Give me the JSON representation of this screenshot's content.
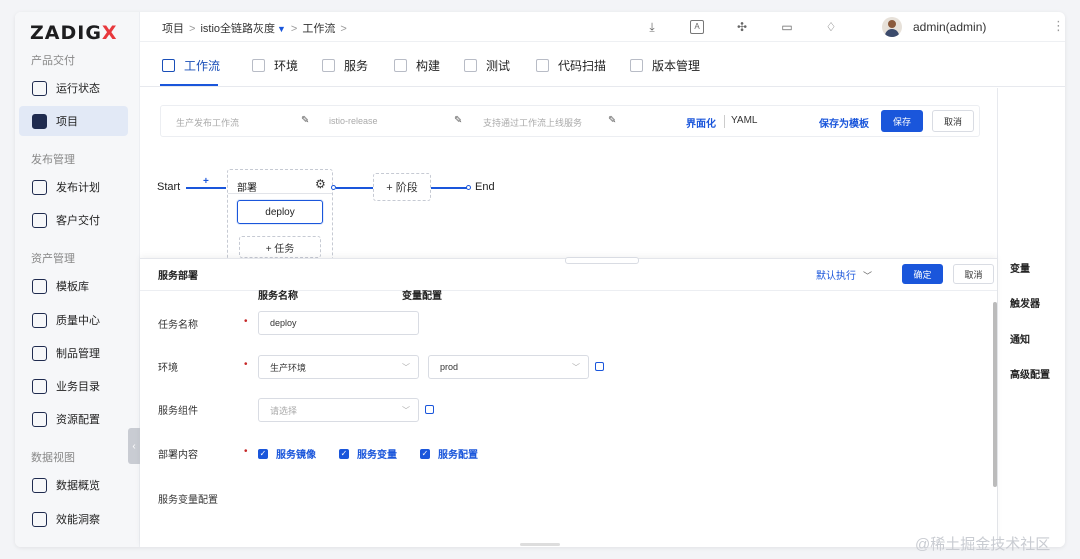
{
  "brand": {
    "logo_main": "ZADIG",
    "logo_x": "X"
  },
  "sidebar": {
    "sections": [
      {
        "label": "产品交付"
      },
      {
        "label": "发布管理"
      },
      {
        "label": "资产管理"
      },
      {
        "label": "数据视图"
      }
    ],
    "items": [
      {
        "label": "运行状态",
        "icon": "pulse-icon"
      },
      {
        "label": "项目",
        "icon": "project-icon",
        "active": true
      },
      {
        "label": "发布计划",
        "icon": "plan-icon"
      },
      {
        "label": "客户交付",
        "icon": "delivery-icon"
      },
      {
        "label": "模板库",
        "icon": "template-icon"
      },
      {
        "label": "质量中心",
        "icon": "flask-icon"
      },
      {
        "label": "制品管理",
        "icon": "artifact-icon"
      },
      {
        "label": "业务目录",
        "icon": "catalog-icon"
      },
      {
        "label": "资源配置",
        "icon": "gear-icon"
      },
      {
        "label": "数据概览",
        "icon": "dashboard-icon"
      },
      {
        "label": "效能洞察",
        "icon": "pie-icon"
      }
    ]
  },
  "header": {
    "breadcrumb": [
      "项目",
      "istio全链路灰度",
      "工作流"
    ],
    "username": "admin(admin)"
  },
  "tabs": [
    {
      "label": "工作流",
      "active": true
    },
    {
      "label": "环境"
    },
    {
      "label": "服务"
    },
    {
      "label": "构建"
    },
    {
      "label": "测试"
    },
    {
      "label": "代码扫描"
    },
    {
      "label": "版本管理"
    }
  ],
  "workflow": {
    "name_placeholder": "生产发布工作流",
    "key_placeholder": "istio-release",
    "desc_placeholder": "支持通过工作流上线服务",
    "mode_gui": "界面化",
    "mode_yaml": "YAML",
    "save_template": "保存为模板",
    "save": "保存",
    "cancel": "取消",
    "start": "Start",
    "end": "End",
    "stage_name": "部署",
    "job_name": "deploy",
    "add_task": "+ 任务",
    "add_stage": "+ 阶段",
    "plus": "+"
  },
  "right_panel": [
    "变量",
    "触发器",
    "通知",
    "高级配置"
  ],
  "drawer": {
    "title": "服务部署",
    "run_mode": "默认执行",
    "confirm": "确定",
    "cancel": "取消",
    "fields": {
      "task_name_label": "任务名称",
      "task_name_value": "deploy",
      "env_label": "环境",
      "env_value": "生产环境",
      "env_namespace": "prod",
      "component_label": "服务组件",
      "component_placeholder": "请选择",
      "content_label": "部署内容",
      "content_options": [
        "服务镜像",
        "服务变量",
        "服务配置"
      ],
      "var_config_label": "服务变量配置",
      "col_service": "服务名称",
      "col_vars": "变量配置"
    }
  },
  "watermark": "@稀土掘金技术社区"
}
